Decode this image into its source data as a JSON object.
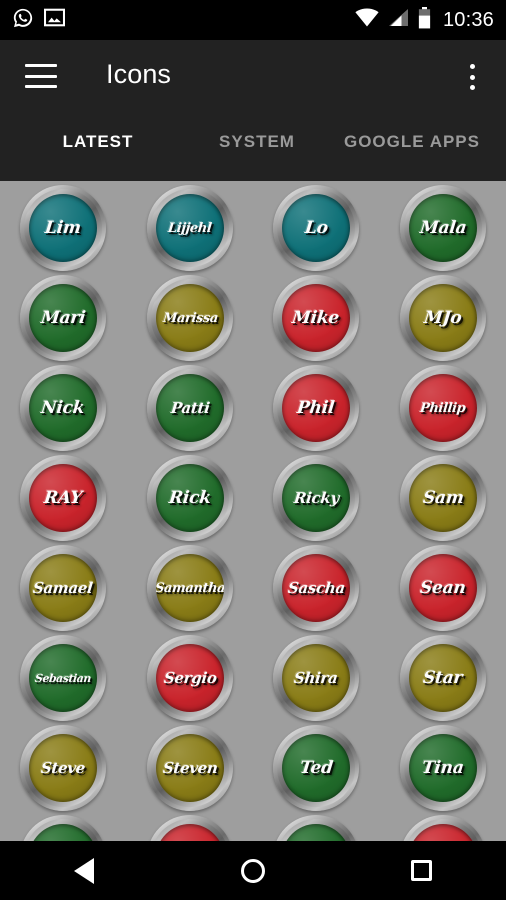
{
  "status_bar": {
    "time": "10:36",
    "left_icons": [
      "whatsapp-icon",
      "gallery-icon"
    ],
    "right_icons": [
      "wifi-icon",
      "signal-icon",
      "battery-icon"
    ]
  },
  "app_bar": {
    "menu_icon": "hamburger-menu-icon",
    "title": "Icons",
    "overflow_icon": "overflow-menu-icon",
    "tabs": [
      {
        "label": "LATEST",
        "active": true
      },
      {
        "label": "SYSTEM",
        "active": false
      },
      {
        "label": "GOOGLE APPS",
        "active": false
      }
    ],
    "indicator_color": "#e8335d",
    "background_color": "#222222"
  },
  "grid": {
    "background_color": "#9e9e9e",
    "columns": 4,
    "palette": {
      "teal": "#0e7077",
      "green": "#206b2a",
      "red": "#c9232b",
      "olive": "#897c16"
    },
    "icons": [
      {
        "label": "Lim",
        "color": "teal"
      },
      {
        "label": "Lijjehl",
        "color": "teal"
      },
      {
        "label": "Lo",
        "color": "teal"
      },
      {
        "label": "Mala",
        "color": "green"
      },
      {
        "label": "Mari",
        "color": "green"
      },
      {
        "label": "Marissa",
        "color": "olive"
      },
      {
        "label": "Mike",
        "color": "red"
      },
      {
        "label": "MJo",
        "color": "olive"
      },
      {
        "label": "Nick",
        "color": "green"
      },
      {
        "label": "Patti",
        "color": "green"
      },
      {
        "label": "Phil",
        "color": "red"
      },
      {
        "label": "Phillip",
        "color": "red"
      },
      {
        "label": "RAY",
        "color": "red"
      },
      {
        "label": "Rick",
        "color": "green"
      },
      {
        "label": "Ricky",
        "color": "green"
      },
      {
        "label": "Sam",
        "color": "olive"
      },
      {
        "label": "Samael",
        "color": "olive"
      },
      {
        "label": "Samantha",
        "color": "olive"
      },
      {
        "label": "Sascha",
        "color": "red"
      },
      {
        "label": "Sean",
        "color": "red"
      },
      {
        "label": "Sebastian",
        "color": "green"
      },
      {
        "label": "Sergio",
        "color": "red"
      },
      {
        "label": "Shira",
        "color": "olive"
      },
      {
        "label": "Star",
        "color": "olive"
      },
      {
        "label": "Steve",
        "color": "olive"
      },
      {
        "label": "Steven",
        "color": "olive"
      },
      {
        "label": "Ted",
        "color": "green"
      },
      {
        "label": "Tina",
        "color": "green"
      },
      {
        "label": "",
        "color": "green"
      },
      {
        "label": "",
        "color": "red"
      },
      {
        "label": "",
        "color": "green"
      },
      {
        "label": "",
        "color": "red"
      }
    ]
  },
  "nav_bar": {
    "back_label": "Back",
    "home_label": "Home",
    "recents_label": "Recents"
  }
}
